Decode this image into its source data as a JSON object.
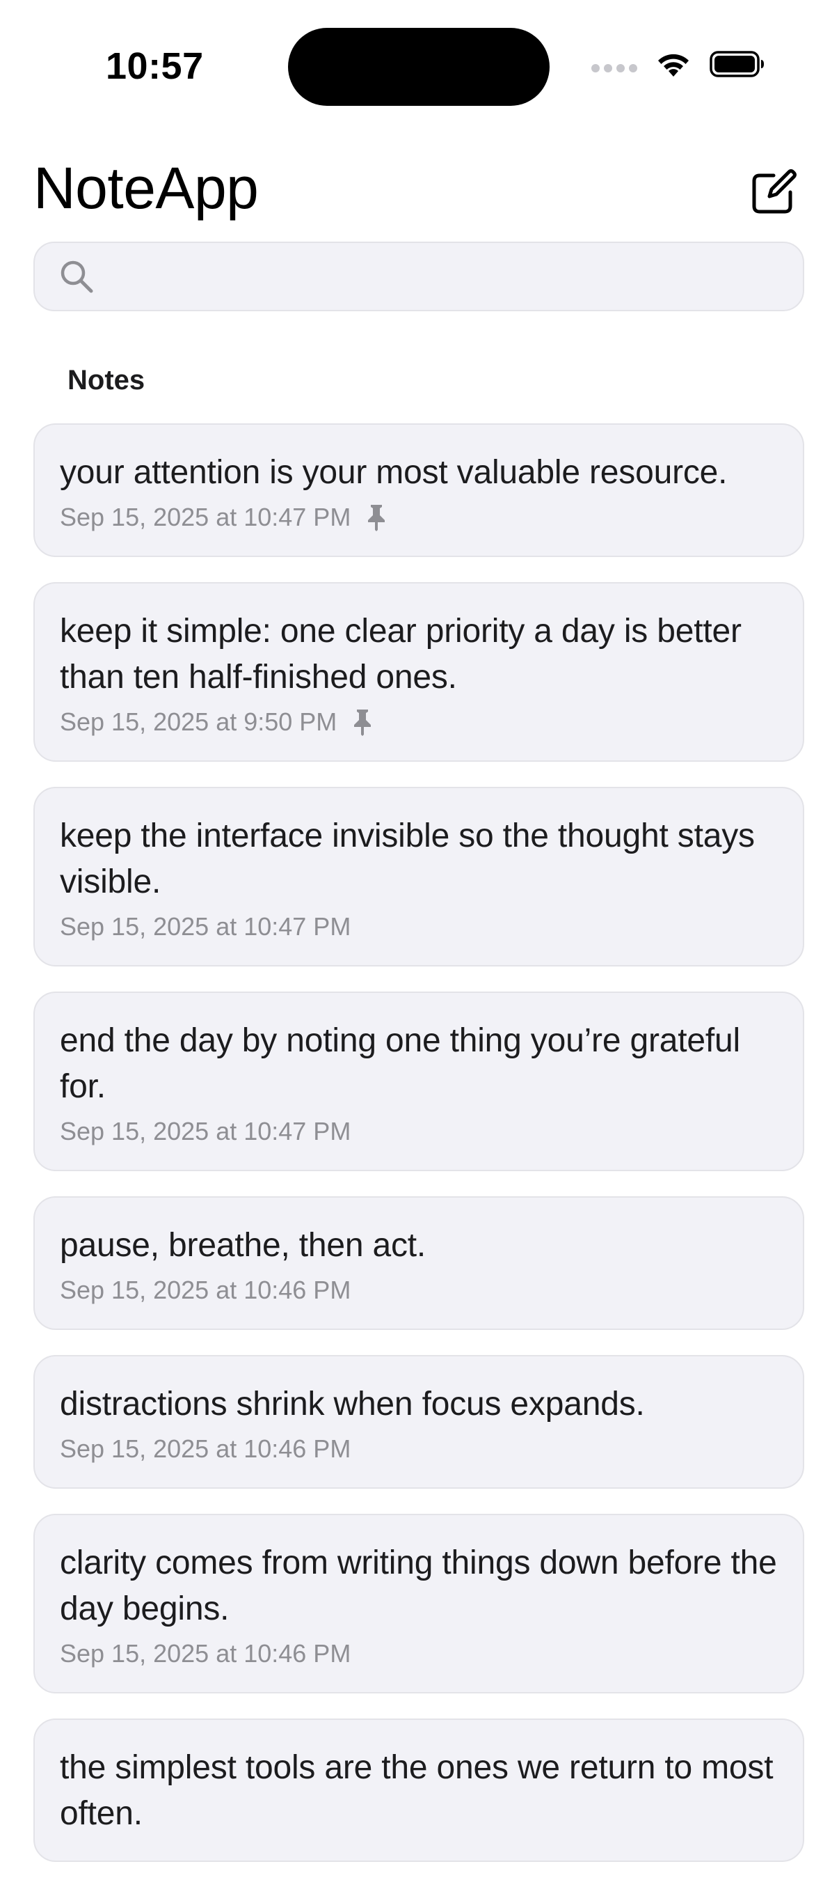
{
  "status_bar": {
    "time": "10:57",
    "icons": [
      "signal-icon",
      "wifi-icon",
      "battery-icon"
    ]
  },
  "header": {
    "title": "NoteApp",
    "compose_icon": "compose-icon"
  },
  "search": {
    "placeholder": "",
    "value": "",
    "icon": "search-icon"
  },
  "section": {
    "title": "Notes"
  },
  "notes": [
    {
      "text": "your attention is your most valuable resource.",
      "date": "Sep 15, 2025 at 10:47 PM",
      "pinned": true
    },
    {
      "text": "keep it simple: one clear priority a day is better than ten half-finished ones.",
      "date": "Sep 15, 2025 at 9:50 PM",
      "pinned": true
    },
    {
      "text": "keep the interface invisible so the thought stays visible.",
      "date": "Sep 15, 2025 at 10:47 PM",
      "pinned": false
    },
    {
      "text": "end the day by noting one thing you’re grateful for.",
      "date": "Sep 15, 2025 at 10:47 PM",
      "pinned": false
    },
    {
      "text": "pause, breathe, then act.",
      "date": "Sep 15, 2025 at 10:46 PM",
      "pinned": false
    },
    {
      "text": "distractions shrink when focus expands.",
      "date": "Sep 15, 2025 at 10:46 PM",
      "pinned": false
    },
    {
      "text": "clarity comes from writing things down before the day begins.",
      "date": "Sep 15, 2025 at 10:46 PM",
      "pinned": false
    },
    {
      "text": "the simplest tools are the ones we return to most often.",
      "date": "",
      "pinned": false
    }
  ],
  "colors": {
    "card_background": "#f2f2f7",
    "card_border": "#e3e3e8",
    "secondary_text": "#8e8e93"
  }
}
